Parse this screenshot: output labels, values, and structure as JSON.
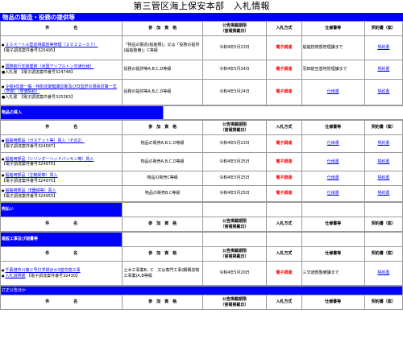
{
  "title": "第三管区海上保安本部　入札情報",
  "headers": {
    "name": "件　　　　　　名",
    "qual": "参　加　資　格",
    "date": "公告掲載期限\n（官報掲載日）",
    "method": "入札方式",
    "spec": "仕様書等",
    "contract": "契約書（案）"
  },
  "sections": {
    "manufacturing": "物品の製造・役務の提供等",
    "purchase": "物品の買入",
    "sale": "売払い",
    "construction": "建設工事及び測量等",
    "correction": "訂正公告ほか"
  },
  "manufacturing_rows": [
    {
      "name": "２０メートル型巡視艇岩美修理（２０２２－０７）",
      "ref": "【電子調達案件番号325495】",
      "qual": "「物品の製造(船舶類)」又は「役務の提供(船舶整備)」C等級",
      "date": "令和4年5月23日",
      "method": "電子調達",
      "spec": "船舶技術部管理課まで",
      "contract": "契約書"
    },
    {
      "name": "国際航行支援業務（米国アップルトン交通仕様）",
      "ref": "●入札書　【電子調達案件番号324748】",
      "qual": "役務の提供等A,B,C,D等級",
      "date": "令和4年5月24日",
      "method": "電子調達",
      "spec": "羽田航空基地管理課まで",
      "contract": "契約書"
    },
    {
      "name": "令和4年度一般・特別定期健康診断及び日型肝炎感染対策一式（茨城）（単価契約）",
      "ref": "●入札書　【電子調達案件番号325363】",
      "qual": "役務の提供等A,B,C,D等級",
      "date": "令和4年5月24日",
      "method": "電子調達",
      "spec": "仕様書",
      "contract": "契約書"
    }
  ],
  "purchase_rows": [
    {
      "name": "船舶用部品（ガスケット等）買入（その2）",
      "ref": "【電子調達案件番号324587】",
      "qual": "物品の販売A,B,C,D等級",
      "date": "令和4年5月23日",
      "method": "電子調達",
      "spec": "仕様書",
      "contract": "契約書"
    },
    {
      "name": "船舶用部品（シリンダーヘッドパッキン等）買入",
      "ref": "【電子調達案件番号324970】",
      "qual": "物品の販売A,B,C,D等級",
      "date": "令和4年5月25日",
      "method": "電子調達",
      "spec": "仕様書",
      "contract": "契約書"
    },
    {
      "name": "船舶用部品（主軸受等）買入",
      "ref": "【電子調達案件番号324975】",
      "qual": "物品の販売C等級",
      "date": "令和4年5月25日",
      "method": "電子調達",
      "spec": "仕様書",
      "contract": "契約書"
    },
    {
      "name": "船舶用部品（E器械等）買入",
      "ref": "【電子調達案件番号324955】",
      "qual": "物品の販売B,C等級",
      "date": "令和4年5月25日",
      "method": "電子調達",
      "spec": "仕様書",
      "contract": "契約書"
    }
  ],
  "construction_rows": [
    {
      "name": "千葉港市川第三号灯浮標ほか3基交換工事",
      "link2": "入札説明書",
      "ref": "【電子調達案件番号32430】",
      "qual": "土木工事業B、C　又は専門工事(鋼構造物工事業)A,B等級",
      "date": "令和4年5月20日",
      "method": "電子調達",
      "spec": "三交通部整備課まで",
      "contract": "契約書"
    }
  ]
}
